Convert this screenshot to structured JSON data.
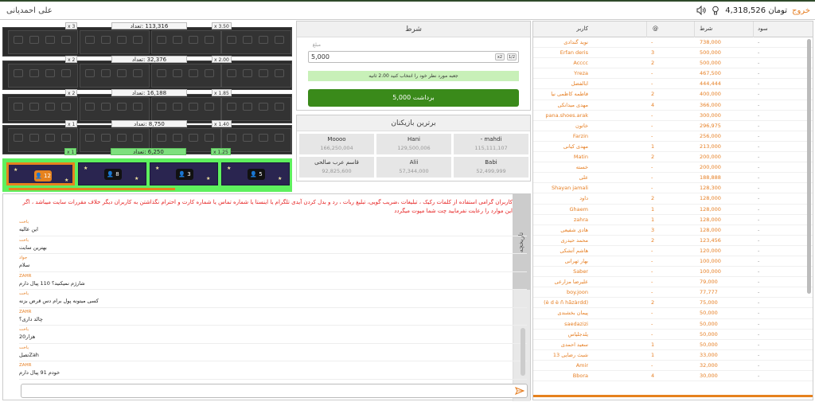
{
  "topbar": {
    "username": "علی احمدیانی",
    "balance": "4,318,526 تومان",
    "logout": "خروج"
  },
  "game": {
    "stages": [
      {
        "label": "113,316 :تعداد",
        "mult": "x 3.50",
        "count": "x 3"
      },
      {
        "label": "32,376 :تعداد",
        "mult": "x 2.00",
        "count": "x 2"
      },
      {
        "label": "16,188 :تعداد",
        "mult": "x 1.85",
        "count": "x 2"
      },
      {
        "label": "8,750 :تعداد",
        "mult": "x 1.40",
        "count": "x 1"
      },
      {
        "label": "6,250 :تعداد",
        "mult": "x 1.25",
        "count": "x 1"
      }
    ],
    "doors": [
      "12",
      "8",
      "3",
      "5"
    ],
    "progress": 0.58
  },
  "bet": {
    "title": "شرط",
    "amount_label": "مبلغ",
    "amount": "5,000",
    "half": "1/2",
    "double": "x2",
    "note": "جعبه مورد نظر خود را انتخاب کنید 2.00 ثانیه",
    "withdraw": "برداشت 5,000"
  },
  "top_players": {
    "title": "برترین بازیکنان",
    "items": [
      {
        "name": "mahdi -",
        "value": "115,111,107"
      },
      {
        "name": "Hani",
        "value": "129,500,006"
      },
      {
        "name": "Moooo",
        "value": "166,250,004"
      },
      {
        "name": "Babi",
        "value": "52,499,999"
      },
      {
        "name": "Alii",
        "value": "57,344,000"
      },
      {
        "name": "قاسم عرب صالحی",
        "value": "92,825,600"
      }
    ]
  },
  "chat": {
    "tab_history": "تاریخچه",
    "tab_chat": "چت",
    "warning": "کاربران گرامی استفاده از کلمات رکیک ، تبلیغات ،ضریب گویی، تبلیغ ربات ، رد و بدل کردن آیدی تلگرام یا اینستا یا شماره تماس یا شماره کارت و احترام نگذاشتن به کاربران دیگر خلاف مقررات سایت میباشد ، اگر این موارد را رعایت نفرمایید چت شما مپوت میگردد",
    "messages": [
      {
        "user": "باخت",
        "text": "این عالیه"
      },
      {
        "user": "باخت",
        "text": "بهترین سایت"
      },
      {
        "user": "جواد",
        "text": "سلام"
      },
      {
        "user": "ZAHR",
        "text": "شارژم نمیکنید؟ 110 پیال دارم"
      },
      {
        "user": "باخت",
        "text": "کسی میتونه پول برام دس قرض بزنه"
      },
      {
        "user": "ZAHR",
        "text": "چالد داری؟"
      },
      {
        "user": "باخت",
        "text": "هزار20"
      },
      {
        "user": "باخت",
        "text": "Zahتصل"
      },
      {
        "user": "ZAHR",
        "text": "خودم 91 پیال دارم"
      }
    ]
  },
  "table": {
    "headers": {
      "user": "کاربر",
      "at": "@",
      "bet": "شرط",
      "profit": "سود"
    },
    "rows": [
      {
        "user": "نوید گندادی",
        "at": "-",
        "bet": "738,000",
        "profit": "-"
      },
      {
        "user": "Erfan deris",
        "at": "3",
        "bet": "500,000",
        "profit": "-"
      },
      {
        "user": "Acccc",
        "at": "2",
        "bet": "500,000",
        "profit": "-"
      },
      {
        "user": "Yreza",
        "at": "-",
        "bet": "467,500",
        "profit": "-"
      },
      {
        "user": "ابالفضل",
        "at": "-",
        "bet": "444,444",
        "profit": "-"
      },
      {
        "user": "فاطمه کاظمی نیا",
        "at": "2",
        "bet": "400,000",
        "profit": "-"
      },
      {
        "user": "مهدی میدانکی",
        "at": "4",
        "bet": "366,000",
        "profit": "-"
      },
      {
        "user": "pana.shoes.arak",
        "at": "-",
        "bet": "300,000",
        "profit": "-"
      },
      {
        "user": "خاتون",
        "at": "-",
        "bet": "296,975",
        "profit": "-"
      },
      {
        "user": "Farzin",
        "at": "-",
        "bet": "256,000",
        "profit": "-"
      },
      {
        "user": "مهدی کیانی",
        "at": "1",
        "bet": "213,000",
        "profit": "-"
      },
      {
        "user": "Matin",
        "at": "2",
        "bet": "200,000",
        "profit": "-"
      },
      {
        "user": "خسته",
        "at": "-",
        "bet": "200,000",
        "profit": "-"
      },
      {
        "user": "علی",
        "at": "-",
        "bet": "188,888",
        "profit": "-"
      },
      {
        "user": "Shayan jamali",
        "at": "-",
        "bet": "128,300",
        "profit": "-"
      },
      {
        "user": "داود",
        "at": "2",
        "bet": "128,000",
        "profit": "-"
      },
      {
        "user": "Ghaem",
        "at": "1",
        "bet": "128,000",
        "profit": "-"
      },
      {
        "user": "zahra",
        "at": "1",
        "bet": "128,000",
        "profit": "-"
      },
      {
        "user": "هادی شفیعی",
        "at": "3",
        "bet": "128,000",
        "profit": "-"
      },
      {
        "user": "محمد حیدری",
        "at": "2",
        "bet": "123,456",
        "profit": "-"
      },
      {
        "user": "هاشم آتشکی",
        "at": "-",
        "bet": "120,000",
        "profit": "-"
      },
      {
        "user": "بهار ثهرانی",
        "at": "-",
        "bet": "100,000",
        "profit": "-"
      },
      {
        "user": "Saber",
        "at": "-",
        "bet": "100,000",
        "profit": "-"
      },
      {
        "user": "علیرضا مزارعی",
        "at": "-",
        "bet": "79,000",
        "profit": "-"
      },
      {
        "user": "boy.joon",
        "at": "-",
        "bet": "77,777",
        "profit": "-"
      },
      {
        "user": "(è d è ñ hãzàrdd)",
        "at": "2",
        "bet": "75,000",
        "profit": "-"
      },
      {
        "user": "پیمان بخشندی",
        "at": "-",
        "bet": "50,000",
        "profit": "-"
      },
      {
        "user": "saedazizi",
        "at": "-",
        "bet": "50,000",
        "profit": "-"
      },
      {
        "user": "یلدجلیاس",
        "at": "-",
        "bet": "50,000",
        "profit": "-"
      },
      {
        "user": "سعید احمدی",
        "at": "1",
        "bet": "50,000",
        "profit": "-"
      },
      {
        "user": "شبث رضایی 13",
        "at": "1",
        "bet": "33,000",
        "profit": "-"
      },
      {
        "user": "Amir",
        "at": "-",
        "bet": "32,000",
        "profit": "-"
      },
      {
        "user": "Bbora",
        "at": "4",
        "bet": "30,000",
        "profit": "-"
      }
    ]
  }
}
